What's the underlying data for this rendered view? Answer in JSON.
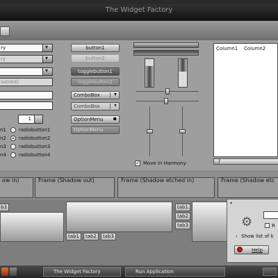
{
  "window": {
    "title": "The Widget Factory"
  },
  "combos": {
    "entry1": "ry",
    "entry2": "ry",
    "entry3": "",
    "entry4": "sabled)"
  },
  "spin": {
    "value": "1"
  },
  "radios": [
    {
      "label": "radiobutton1",
      "checked": false
    },
    {
      "label": "radiobutton2",
      "checked": true
    },
    {
      "label": "radiobutton3",
      "checked": false
    },
    {
      "label": "radiobutton4",
      "checked": false
    }
  ],
  "radio_left_labels": [
    "n1",
    "n2",
    "n3",
    "n4"
  ],
  "buttons": {
    "button1": "button1",
    "button2": "button2",
    "togglebutton1": "togglebutton1",
    "togglebutton2": "togglebutton2",
    "combobox1": "ComboBox",
    "combobox2": "ComboBox",
    "optionmenu1": "OptionMenu",
    "optionmenu2": "OptionMenu"
  },
  "checks": {
    "move_in_harmony": "Move In Harmony",
    "move_in_harmony_checked": true
  },
  "scales": {
    "h1": 0.6,
    "h2": 0.55,
    "v1": 0.45,
    "v2": 0.45
  },
  "treeview": {
    "columns": [
      "Column1",
      "Column2"
    ]
  },
  "frames": [
    {
      "label": "ow in)"
    },
    {
      "label": "Frame (Shadow out)"
    },
    {
      "label": "Frame (Shadow etched in)"
    },
    {
      "label": "Frame (Shadow etc"
    }
  ],
  "tabs": {
    "left_top": "b3",
    "bottom": [
      "tab1",
      "tab2",
      "tab3"
    ],
    "right": [
      "tab1",
      "tab2",
      "tab3"
    ]
  },
  "dialog": {
    "checkbox_label": "R",
    "expander_label": "Show list of k",
    "help_button": "Help"
  },
  "taskbar": {
    "items": [
      "The Widget Factory",
      "Run Application"
    ]
  }
}
